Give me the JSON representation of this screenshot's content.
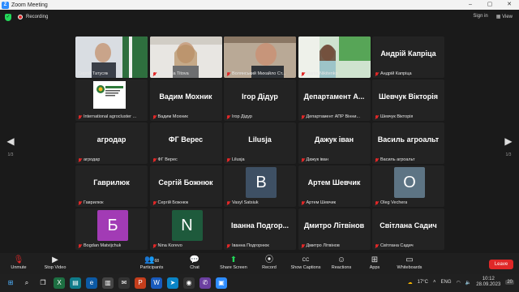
{
  "window": {
    "title": "Zoom Meeting",
    "minimize": "–",
    "maximize": "▢",
    "close": "✕"
  },
  "top": {
    "recording": "Recording",
    "sign_in": "Sign in",
    "view": "View"
  },
  "pager": {
    "left": "1/3",
    "right": "1/3"
  },
  "tiles": [
    {
      "name": "tile-sergiy-tatusyak",
      "big": "",
      "label": "Сергій Татусяк",
      "muted": false,
      "video": "man1"
    },
    {
      "name": "tile-liudmyla-titova",
      "big": "",
      "label": "Liudmyla Titova",
      "muted": true,
      "video": "woman1"
    },
    {
      "name": "tile-voliansky",
      "big": "",
      "label": "Волянський Михайло Ст...",
      "muted": true,
      "video": "man2"
    },
    {
      "name": "tile-mariia-nikitenko",
      "big": "",
      "label": "Mariia Nikitenko",
      "muted": true,
      "video": "woman2"
    },
    {
      "name": "tile-andriy-kaprytsia",
      "big": "Андрій Капріца",
      "label": "Андрій Капріца",
      "muted": true
    },
    {
      "name": "tile-international-agrocluster",
      "big": "",
      "label": "International agrocluster ...",
      "muted": true,
      "video": "logo"
    },
    {
      "name": "tile-vadym-mokhnyk",
      "big": "Вадим Мохник",
      "label": "Вадим Мохник",
      "muted": true
    },
    {
      "name": "tile-ihor-didur",
      "big": "Ігор Дідур",
      "label": "Ігор Дідур",
      "muted": true
    },
    {
      "name": "tile-departament-apr",
      "big": "Департамент  А...",
      "label": "Департамент АПР Вінни...",
      "muted": true
    },
    {
      "name": "tile-shevchuk-viktoria",
      "big": "Шевчук Вікторія",
      "label": "Шевчук Вікторія",
      "muted": true
    },
    {
      "name": "tile-ahrodar",
      "big": "агродар",
      "label": "агродар",
      "muted": true
    },
    {
      "name": "tile-fg-veres",
      "big": "ФГ Верес",
      "label": "ФГ Верес",
      "muted": true
    },
    {
      "name": "tile-lilusja",
      "big": "Lilusja",
      "label": "Lilusja",
      "muted": true
    },
    {
      "name": "tile-dazhuk-ivan",
      "big": "Дажук іван",
      "label": "Дажук іван",
      "muted": true
    },
    {
      "name": "tile-vasyl-ahroalt",
      "big": "Василь агроальт",
      "label": "Василь агроальт",
      "muted": true
    },
    {
      "name": "tile-havryliuk",
      "big": "Гаврилюк",
      "label": "Гаврилюк",
      "muted": true
    },
    {
      "name": "tile-serhiy-bozhniuk",
      "big": "Сергій Божнюк",
      "label": "Сергій Божнюк",
      "muted": true
    },
    {
      "name": "tile-vasyl-satsiuk",
      "big": "",
      "label": "Vasyl Satsiuk",
      "muted": true,
      "avatar": "В",
      "avatar_color": "#3e5064"
    },
    {
      "name": "tile-artem-shevchyk",
      "big": "Артем Шевчик",
      "label": "Артем Шевчик",
      "muted": true
    },
    {
      "name": "tile-oleg-vechera",
      "big": "",
      "label": "Oleg Vechera",
      "muted": true,
      "avatar": "O",
      "avatar_color": "#5d7484"
    },
    {
      "name": "tile-bogdan-matvijchuk",
      "big": "",
      "label": "Bogdan Matvijchuk",
      "muted": true,
      "avatar": "Б",
      "avatar_color": "#a23bb5"
    },
    {
      "name": "tile-nina-korevo",
      "big": "",
      "label": "Nina Korevo",
      "muted": true,
      "avatar": "N",
      "avatar_color": "#1e5a3c"
    },
    {
      "name": "tile-ivanna-podhorn",
      "big": "Іванна  Подгор...",
      "label": "Іванна Подгорнюк",
      "muted": true
    },
    {
      "name": "tile-dmytro-litvinov",
      "big": "Дмитро Літвінов",
      "label": "Дмитро Літвінов",
      "muted": true
    },
    {
      "name": "tile-svitlana-sadych",
      "big": "Світлана Садич",
      "label": "Світлана Садич",
      "muted": true
    }
  ],
  "toolbar": {
    "unmute": "Unmute",
    "stop_video": "Stop Video",
    "participants": "Participants",
    "participants_count": "68",
    "chat": "Chat",
    "share_screen": "Share Screen",
    "record": "Record",
    "captions": "Show Captions",
    "reactions": "Reactions",
    "apps": "Apps",
    "whiteboards": "Whiteboards",
    "leave": "Leave",
    "cc": "CC"
  },
  "taskbar": {
    "weather": "17°C",
    "lang": "ENG",
    "time": "10:12",
    "date": "28.09.2023",
    "badge": "20"
  },
  "colors": {
    "accent_green": "#23d959",
    "leave_red": "#e02828",
    "zoom_blue": "#2d8cff"
  }
}
